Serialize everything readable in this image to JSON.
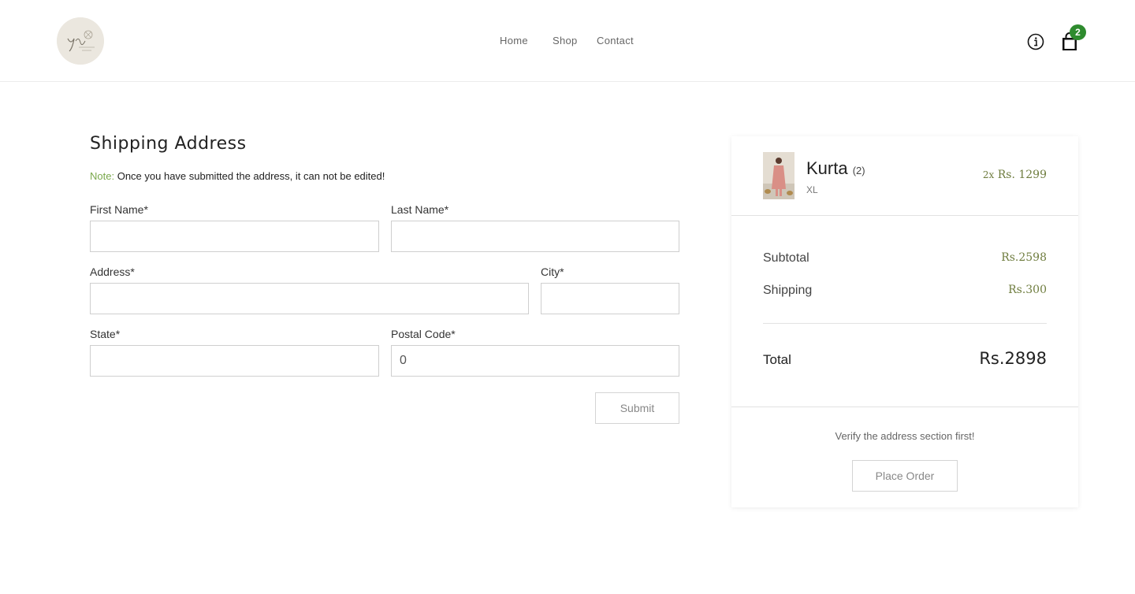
{
  "header": {
    "nav": {
      "home": "Home",
      "shop": "Shop",
      "contact": "Contact"
    },
    "icons": {
      "info": "info-icon",
      "cart": "shopping-bag-icon"
    },
    "cart_count": "2"
  },
  "form": {
    "title": "Shipping Address",
    "note_label": "Note:",
    "note_text": "Once you have submitted the address, it can not be edited!",
    "fields": {
      "first_name": {
        "label": "First Name*",
        "value": ""
      },
      "last_name": {
        "label": "Last Name*",
        "value": ""
      },
      "address": {
        "label": "Address*",
        "value": ""
      },
      "city": {
        "label": "City*",
        "value": ""
      },
      "state": {
        "label": "State*",
        "value": ""
      },
      "postal_code": {
        "label": "Postal Code*",
        "value": "0"
      }
    },
    "submit_label": "Submit"
  },
  "summary": {
    "item": {
      "name": "Kurta",
      "qty": "(2)",
      "size": "XL",
      "multiplier": "2x",
      "price": "Rs. 1299"
    },
    "subtotal_label": "Subtotal",
    "subtotal_value": "Rs.2598",
    "shipping_label": "Shipping",
    "shipping_value": "Rs.300",
    "total_label": "Total",
    "total_value": "Rs.2898",
    "verify_text": "Verify the address section first!",
    "place_order_label": "Place Order"
  },
  "colors": {
    "accent_green": "#7aa84c",
    "price_olive": "#6f7d3f",
    "badge_green": "#2e8b2e"
  }
}
